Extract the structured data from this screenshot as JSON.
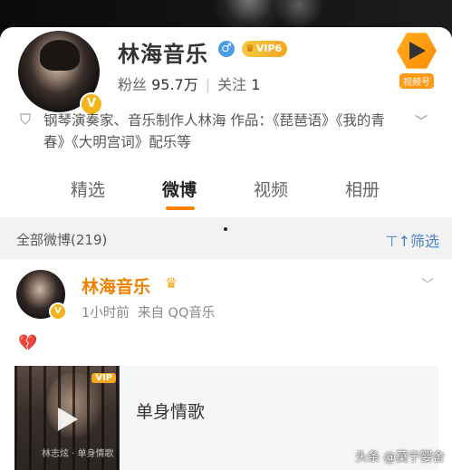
{
  "profile": {
    "name": "林海音乐",
    "gender_icon": "♂",
    "vip_label": "VIP6",
    "stats": {
      "fans_label": "粉丝",
      "fans_value": "95.7万",
      "following_label": "关注",
      "following_value": "1"
    },
    "channel_label": "视频号",
    "verify_icon": "V",
    "bio": "钢琴演奏家、音乐制作人林海 作品：《琵琶语》《我的青春》《大明宫词》配乐等"
  },
  "tabs": [
    {
      "label": "精选"
    },
    {
      "label": "微博"
    },
    {
      "label": "视频"
    },
    {
      "label": "相册"
    }
  ],
  "filter": {
    "all_label": "全部微博(219)",
    "filter_label": "筛选"
  },
  "post": {
    "author": "林海音乐",
    "time": "1小时前",
    "source": "来自 QQ音乐",
    "heart_icon": "💔",
    "music": {
      "title": "单身情歌",
      "cover_badge": "VIP",
      "cover_text": "林志炫 · 单身情歌"
    }
  },
  "watermark": "头条 @莫宁婴舍",
  "colors": {
    "accent_orange": "#ff8200",
    "post_name_orange": "#f08000",
    "filter_blue": "#4b82c6",
    "vip_gold": "#f3a71c"
  }
}
